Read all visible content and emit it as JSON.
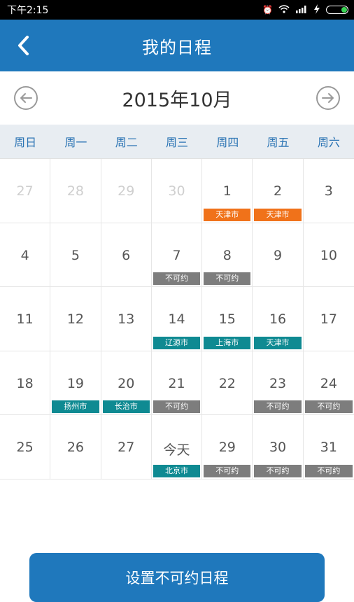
{
  "status": {
    "time": "下午2:15"
  },
  "header": {
    "title": "我的日程"
  },
  "calendar": {
    "month_title": "2015年10月",
    "weekdays": [
      "周日",
      "周一",
      "周二",
      "周三",
      "周四",
      "周五",
      "周六"
    ],
    "days": [
      {
        "label": "27",
        "muted": true,
        "tag": "",
        "tag_color": ""
      },
      {
        "label": "28",
        "muted": true,
        "tag": "",
        "tag_color": ""
      },
      {
        "label": "29",
        "muted": true,
        "tag": "",
        "tag_color": ""
      },
      {
        "label": "30",
        "muted": true,
        "tag": "",
        "tag_color": ""
      },
      {
        "label": "1",
        "muted": false,
        "tag": "天津市",
        "tag_color": "orange"
      },
      {
        "label": "2",
        "muted": false,
        "tag": "天津市",
        "tag_color": "orange"
      },
      {
        "label": "3",
        "muted": false,
        "tag": "",
        "tag_color": ""
      },
      {
        "label": "4",
        "muted": false,
        "tag": "",
        "tag_color": ""
      },
      {
        "label": "5",
        "muted": false,
        "tag": "",
        "tag_color": ""
      },
      {
        "label": "6",
        "muted": false,
        "tag": "",
        "tag_color": ""
      },
      {
        "label": "7",
        "muted": false,
        "tag": "不可约",
        "tag_color": "gray"
      },
      {
        "label": "8",
        "muted": false,
        "tag": "不可约",
        "tag_color": "gray"
      },
      {
        "label": "9",
        "muted": false,
        "tag": "",
        "tag_color": ""
      },
      {
        "label": "10",
        "muted": false,
        "tag": "",
        "tag_color": ""
      },
      {
        "label": "11",
        "muted": false,
        "tag": "",
        "tag_color": ""
      },
      {
        "label": "12",
        "muted": false,
        "tag": "",
        "tag_color": ""
      },
      {
        "label": "13",
        "muted": false,
        "tag": "",
        "tag_color": ""
      },
      {
        "label": "14",
        "muted": false,
        "tag": "辽源市",
        "tag_color": "teal"
      },
      {
        "label": "15",
        "muted": false,
        "tag": "上海市",
        "tag_color": "teal"
      },
      {
        "label": "16",
        "muted": false,
        "tag": "天津市",
        "tag_color": "teal"
      },
      {
        "label": "17",
        "muted": false,
        "tag": "",
        "tag_color": ""
      },
      {
        "label": "18",
        "muted": false,
        "tag": "",
        "tag_color": ""
      },
      {
        "label": "19",
        "muted": false,
        "tag": "扬州市",
        "tag_color": "teal"
      },
      {
        "label": "20",
        "muted": false,
        "tag": "长治市",
        "tag_color": "teal"
      },
      {
        "label": "21",
        "muted": false,
        "tag": "不可约",
        "tag_color": "gray"
      },
      {
        "label": "22",
        "muted": false,
        "tag": "",
        "tag_color": ""
      },
      {
        "label": "23",
        "muted": false,
        "tag": "不可约",
        "tag_color": "gray"
      },
      {
        "label": "24",
        "muted": false,
        "tag": "不可约",
        "tag_color": "gray"
      },
      {
        "label": "25",
        "muted": false,
        "tag": "",
        "tag_color": ""
      },
      {
        "label": "26",
        "muted": false,
        "tag": "",
        "tag_color": ""
      },
      {
        "label": "27",
        "muted": false,
        "tag": "",
        "tag_color": ""
      },
      {
        "label": "今天",
        "muted": false,
        "tag": "北京市",
        "tag_color": "teal"
      },
      {
        "label": "29",
        "muted": false,
        "tag": "不可约",
        "tag_color": "gray"
      },
      {
        "label": "30",
        "muted": false,
        "tag": "不可约",
        "tag_color": "gray"
      },
      {
        "label": "31",
        "muted": false,
        "tag": "不可约",
        "tag_color": "gray"
      }
    ]
  },
  "footer": {
    "button_label": "设置不可约日程"
  },
  "colors": {
    "primary": "#1f78bc",
    "orange": "#f0721a",
    "teal": "#0f8a92",
    "gray": "#7d7d7d"
  }
}
